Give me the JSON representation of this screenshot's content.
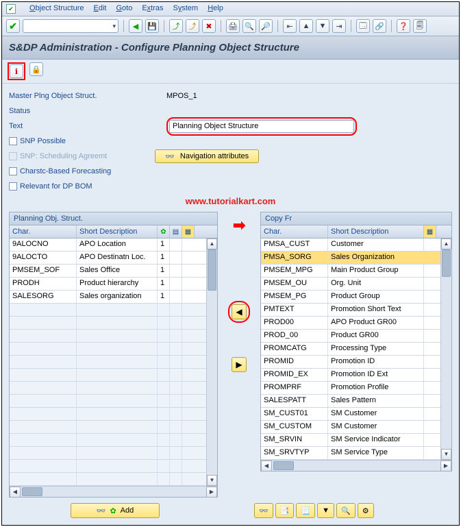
{
  "menu": {
    "items": [
      "Object Structure",
      "Edit",
      "Goto",
      "Extras",
      "System",
      "Help"
    ]
  },
  "title": "S&DP Administration - Configure Planning Object Structure",
  "form": {
    "mpos_label": "Master Plng Object Struct.",
    "mpos_value": "MPOS_1",
    "status_label": "Status",
    "text_label": "Text",
    "text_value": "Planning Object Structure",
    "snp_possible": "SNP Possible",
    "snp_sched": "SNP: Scheduling Agreemt",
    "charstc": "Charstc-Based Forecasting",
    "dp_bom": "Relevant for DP BOM",
    "nav_btn": "Navigation attributes"
  },
  "watermark": "www.tutorialkart.com",
  "left_panel": {
    "title": "Planning Obj. Struct.",
    "cols": {
      "char": "Char.",
      "desc": "Short Description"
    },
    "rows": [
      {
        "c": "9ALOCNO",
        "d": "APO Location",
        "n": "1"
      },
      {
        "c": "9ALOCTO",
        "d": "APO Destinatn Loc.",
        "n": "1"
      },
      {
        "c": "PMSEM_SOF",
        "d": "Sales Office",
        "n": "1"
      },
      {
        "c": "PRODH",
        "d": "Product hierarchy",
        "n": "1"
      },
      {
        "c": "SALESORG",
        "d": "Sales organization",
        "n": "1"
      }
    ],
    "empty_rows": 14
  },
  "right_panel": {
    "title": "Copy Fr",
    "cols": {
      "char": "Char.",
      "desc": "Short Description"
    },
    "rows": [
      {
        "c": "PMSA_CUST",
        "d": "Customer"
      },
      {
        "c": "PMSA_SORG",
        "d": "Sales Organization",
        "sel": true
      },
      {
        "c": "PMSEM_MPG",
        "d": "Main Product Group"
      },
      {
        "c": "PMSEM_OU",
        "d": "Org. Unit"
      },
      {
        "c": "PMSEM_PG",
        "d": "Product Group"
      },
      {
        "c": "PMTEXT",
        "d": "Promotion Short Text"
      },
      {
        "c": "PROD00",
        "d": "APO Product GR00"
      },
      {
        "c": "PROD_00",
        "d": "Product GR00"
      },
      {
        "c": "PROMCATG",
        "d": "Processing Type"
      },
      {
        "c": "PROMID",
        "d": "Promotion ID"
      },
      {
        "c": "PROMID_EX",
        "d": "Promotion ID Ext"
      },
      {
        "c": "PROMPRF",
        "d": "Promotion Profile"
      },
      {
        "c": "SALESPATT",
        "d": "Sales Pattern"
      },
      {
        "c": "SM_CUST01",
        "d": "SM Customer"
      },
      {
        "c": "SM_CUSTOM",
        "d": "SM Customer"
      },
      {
        "c": "SM_SRVIN",
        "d": "SM Service Indicator"
      },
      {
        "c": "SM_SRVTYP",
        "d": "SM Service Type"
      }
    ]
  },
  "add_btn": "Add"
}
